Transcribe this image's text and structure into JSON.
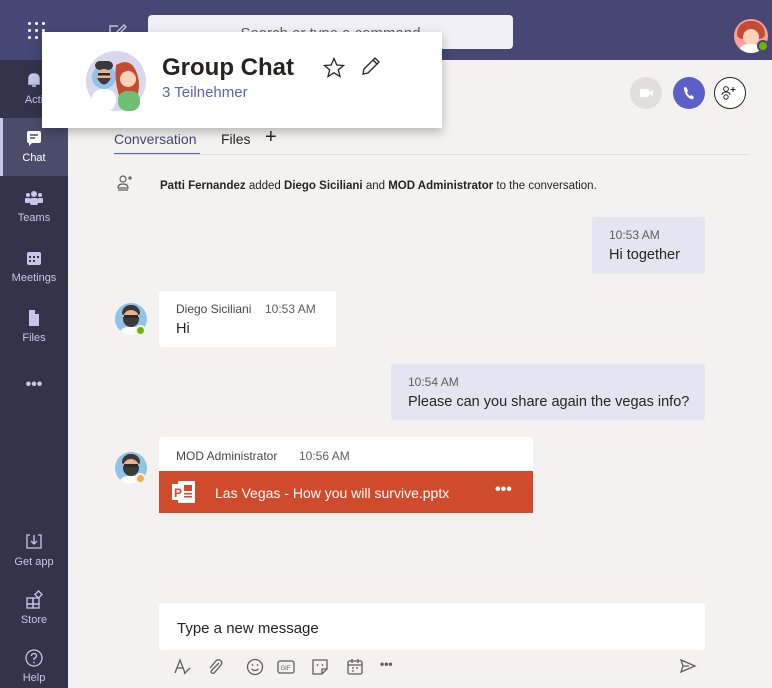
{
  "topbar": {
    "search_placeholder": "Search or type a command"
  },
  "rail": {
    "items": [
      {
        "label": "Activity",
        "visible_label": "Acti"
      },
      {
        "label": "Chat"
      },
      {
        "label": "Teams"
      },
      {
        "label": "Meetings"
      },
      {
        "label": "Files"
      },
      {
        "label": "..."
      },
      {
        "label": "Get app"
      },
      {
        "label": "Store"
      },
      {
        "label": "Help"
      }
    ]
  },
  "header": {
    "title": "Group Chat",
    "subtitle": "3 Teilnehmer",
    "tabs": [
      {
        "label": "Conversation",
        "active": true
      },
      {
        "label": "Files",
        "active": false
      },
      {
        "label": "+",
        "active": false
      }
    ]
  },
  "system_message": {
    "actor": "Patti Fernandez",
    "verb1": " added ",
    "user1": "Diego Siciliani",
    "conj": " and ",
    "user2": "MOD Administrator",
    "tail": " to the conversation."
  },
  "messages": [
    {
      "direction": "out",
      "time": "10:53 AM",
      "text": "Hi together"
    },
    {
      "direction": "in",
      "sender": "Diego Siciliani",
      "time": "10:53 AM",
      "text": "Hi",
      "status": "available"
    },
    {
      "direction": "out",
      "time": "10:54 AM",
      "text": "Please can you share again the vegas info?"
    },
    {
      "direction": "in",
      "sender": "MOD Administrator",
      "time": "10:56 AM",
      "status": "away",
      "attachment": {
        "name": "Las Vegas - How you will survive.pptx",
        "more": "•••",
        "type": "powerpoint"
      }
    }
  ],
  "compose": {
    "placeholder": "Type a new message",
    "more": "•••"
  },
  "colors": {
    "brand": "#464775",
    "rail": "#33344a",
    "accent": "#5b5fc7",
    "ppt": "#d04a2c",
    "available": "#6bb700",
    "away": "#ffaa44"
  }
}
